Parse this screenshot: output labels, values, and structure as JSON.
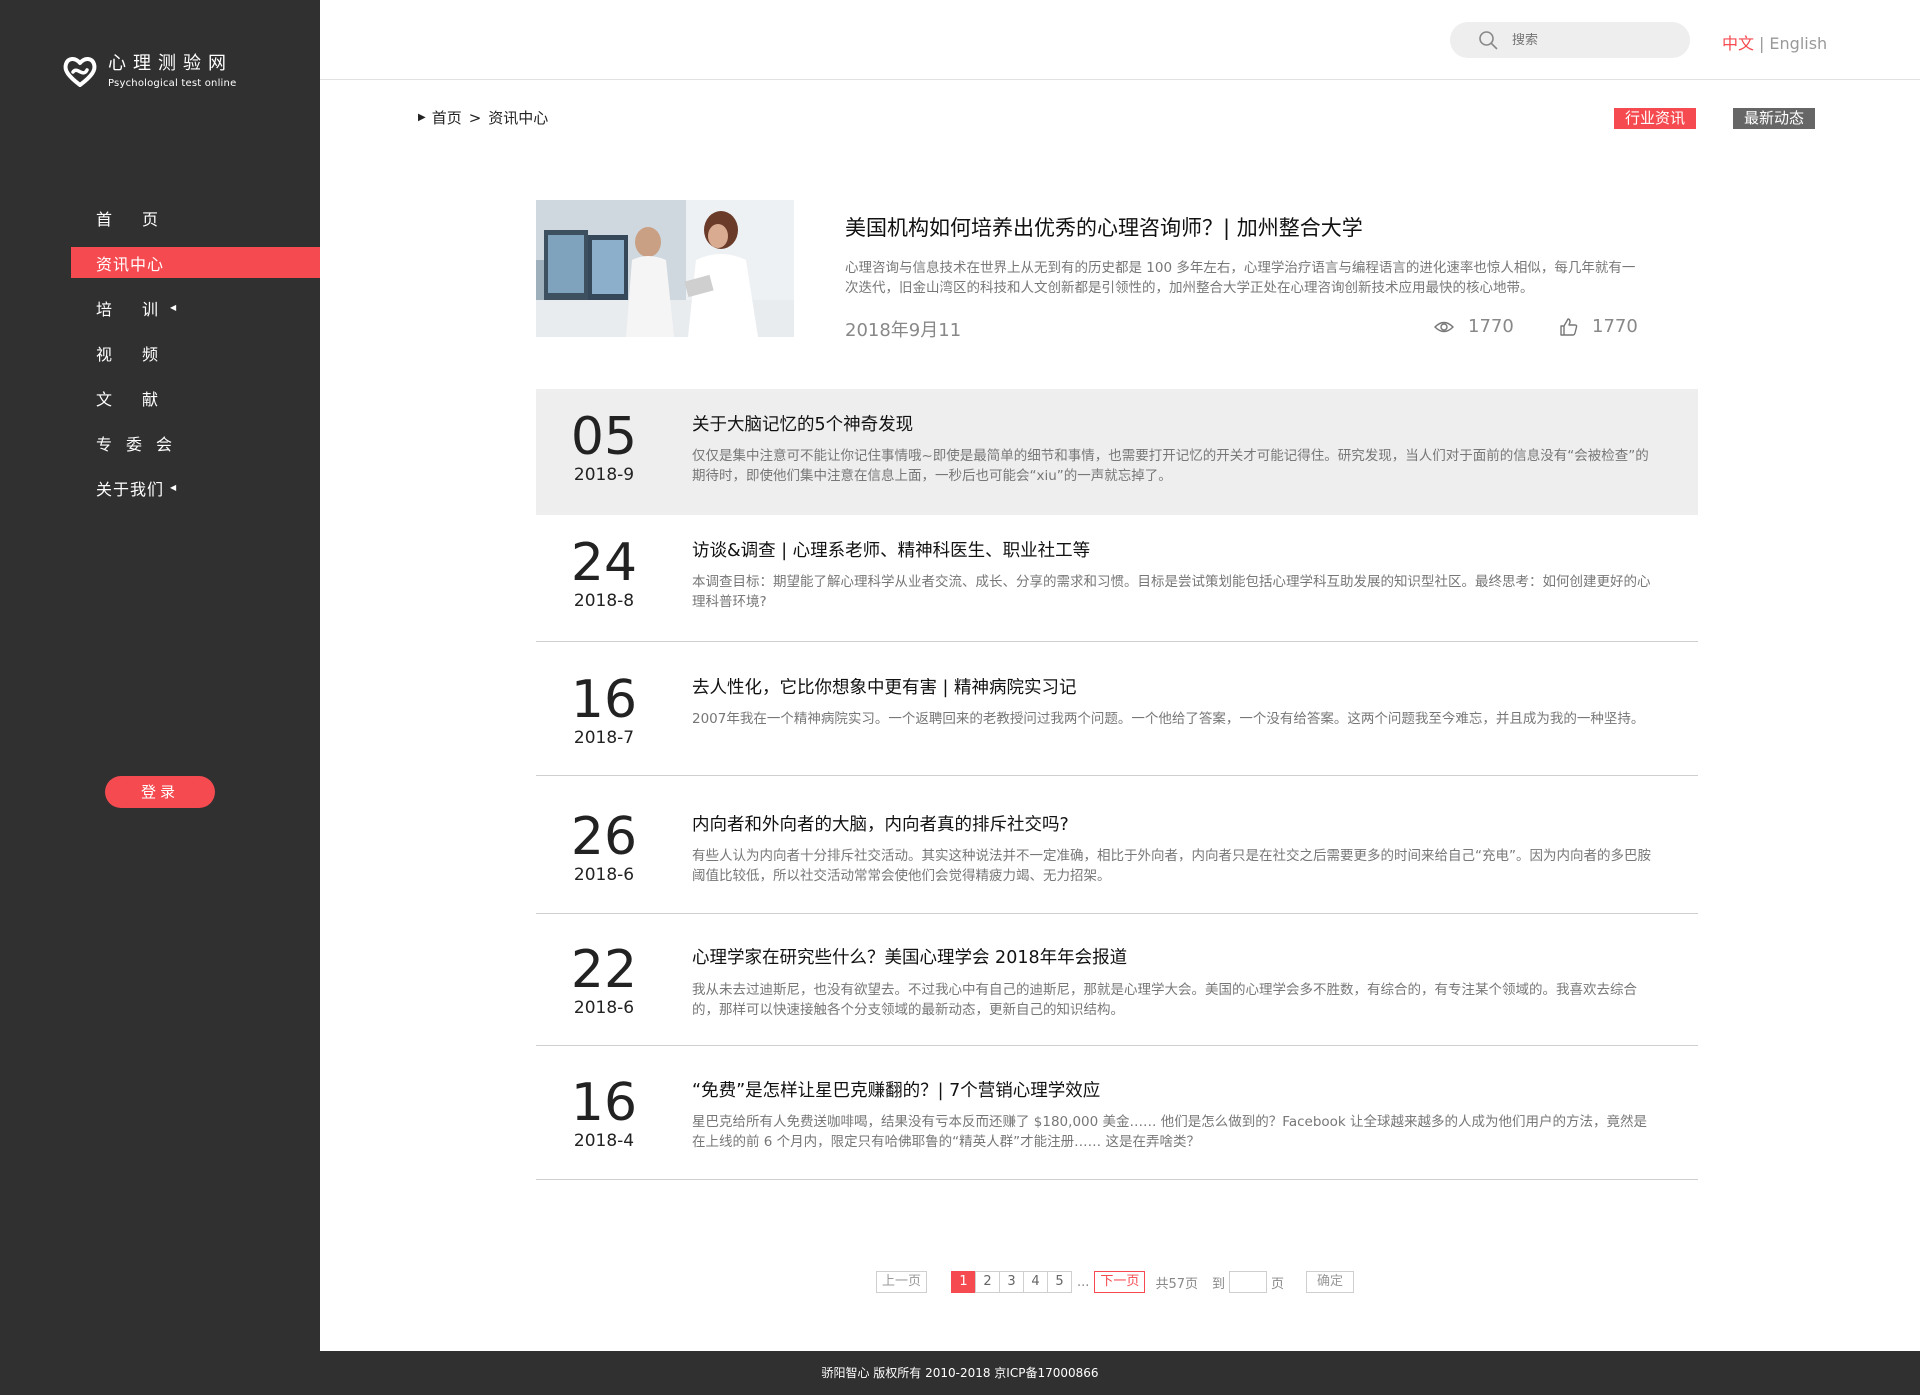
{
  "brand": {
    "title": "心理测验网",
    "subtitle": "Psychological test online"
  },
  "nav": {
    "home": "首页",
    "news": "资讯中心",
    "training": "培训",
    "video": "视频",
    "literature": "文献",
    "committee": "专委会",
    "about": "关于我们"
  },
  "login_label": "登录",
  "search": {
    "placeholder": "搜索"
  },
  "lang": {
    "zh": "中文",
    "sep": "|",
    "en": "English"
  },
  "breadcrumb": {
    "home": "首页",
    "gt": ">",
    "current": "资讯中心"
  },
  "tags": {
    "industry": "行业资讯",
    "latest": "最新动态"
  },
  "featured": {
    "title": "美国机构如何培养出优秀的心理咨询师？| 加州整合大学",
    "desc": "心理咨询与信息技术在世界上从无到有的历史都是 100 多年左右，心理学治疗语言与编程语言的进化速率也惊人相似，每几年就有一次迭代，旧金山湾区的科技和人文创新都是引领性的，加州整合大学正处在心理咨询创新技术应用最快的核心地带。",
    "date": "2018年9月11",
    "views": "1770",
    "likes": "1770"
  },
  "articles": [
    {
      "day": "05",
      "ym": "2018-9",
      "title": "关于大脑记忆的5个神奇发现",
      "desc": "仅仅是集中注意可不能让你记住事情哦~即使是最简单的细节和事情，也需要打开记忆的开关才可能记得住。研究发现，当人们对于面前的信息没有“会被检查”的期待时，即使他们集中注意在信息上面，一秒后也可能会“xiu”的一声就忘掉了。"
    },
    {
      "day": "24",
      "ym": "2018-8",
      "title": "访谈&调查 | 心理系老师、精神科医生、职业社工等",
      "desc": "本调查目标：期望能了解心理科学从业者交流、成长、分享的需求和习惯。目标是尝试策划能包括心理学科互助发展的知识型社区。最终思考：如何创建更好的心理科普环境?"
    },
    {
      "day": "16",
      "ym": "2018-7",
      "title": "去人性化，它比你想象中更有害 | 精神病院实习记",
      "desc": "2007年我在一个精神病院实习。一个返聘回来的老教授问过我两个问题。一个他给了答案，一个没有给答案。这两个问题我至今难忘，并且成为我的一种坚持。"
    },
    {
      "day": "26",
      "ym": "2018-6",
      "title": "内向者和外向者的大脑，内向者真的排斥社交吗?",
      "desc": "有些人认为内向者十分排斥社交活动。其实这种说法并不一定准确，相比于外向者，内向者只是在社交之后需要更多的时间来给自己“充电”。因为内向者的多巴胺阈值比较低，所以社交活动常常会使他们会觉得精疲力竭、无力招架。"
    },
    {
      "day": "22",
      "ym": "2018-6",
      "title": "心理学家在研究些什么？美国心理学会 2018年年会报道",
      "desc": "我从未去过迪斯尼，也没有欲望去。不过我心中有自己的迪斯尼，那就是心理学大会。美国的心理学会多不胜数，有综合的，有专注某个领域的。我喜欢去综合的，那样可以快速接触各个分支领域的最新动态，更新自己的知识结构。"
    },
    {
      "day": "16",
      "ym": "2018-4",
      "title": "“免费”是怎样让星巴克赚翻的？| 7个营销心理学效应",
      "desc": "星巴克给所有人免费送咖啡喝，结果没有亏本反而还赚了 $180,000 美金…… 他们是怎么做到的？Facebook 让全球越来越多的人成为他们用户的方法，竟然是在上线的前 6 个月内，限定只有哈佛耶鲁的“精英人群”才能注册…… 这是在弄啥类？"
    }
  ],
  "pager": {
    "prev": "上一页",
    "pages": [
      "1",
      "2",
      "3",
      "4",
      "5"
    ],
    "current": "1",
    "ellipsis": "...",
    "next": "下一页",
    "total": "共57页",
    "goto": "到",
    "page_unit": "页",
    "confirm": "确定"
  },
  "footer": "骄阳智心 版权所有 2010-2018 京ICP备17000866",
  "colors": {
    "accent": "#f54a4f",
    "sidebar": "#303030",
    "tag_gray": "#666666"
  }
}
